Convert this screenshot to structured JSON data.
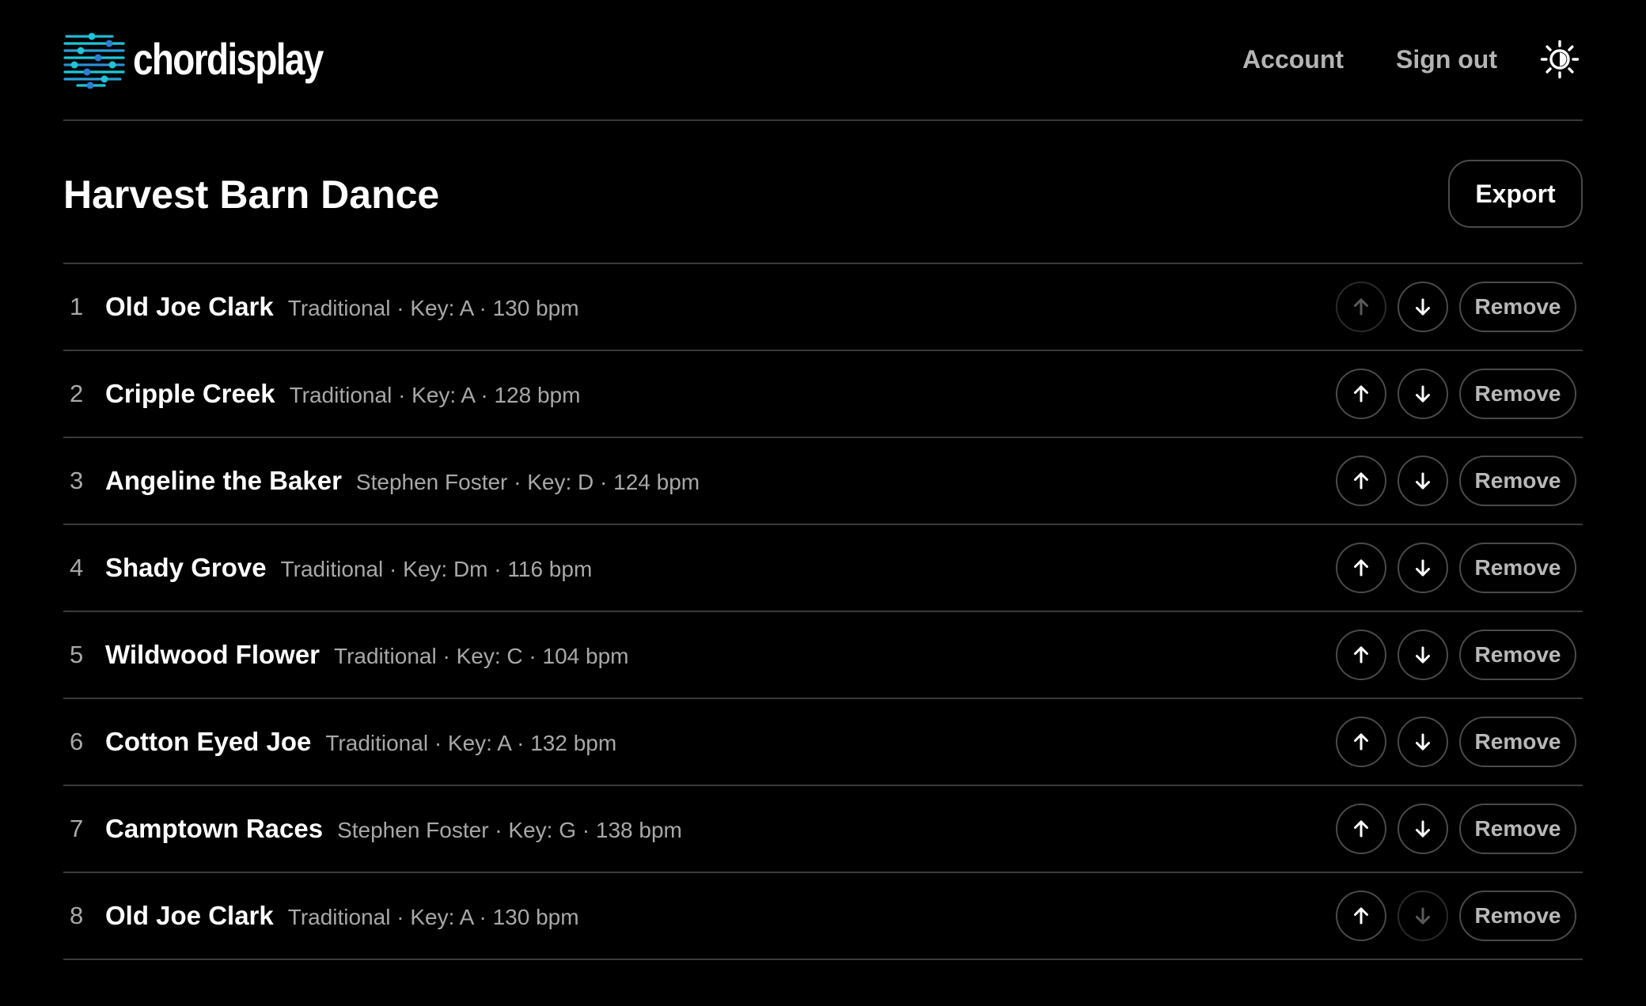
{
  "header": {
    "logo_text": "chordisplay",
    "nav": {
      "account_label": "Account",
      "signout_label": "Sign out"
    },
    "theme_icon": "sun-icon"
  },
  "setlist": {
    "title": "Harvest Barn Dance",
    "export_label": "Export"
  },
  "row_actions": {
    "up_icon": "arrow-up-icon",
    "down_icon": "arrow-down-icon",
    "remove_label": "Remove"
  },
  "songs": [
    {
      "num": "1",
      "title": "Old Joe Clark",
      "meta": "Traditional · Key: A · 130 bpm",
      "up_disabled": true,
      "down_disabled": false
    },
    {
      "num": "2",
      "title": "Cripple Creek",
      "meta": "Traditional · Key: A · 128 bpm",
      "up_disabled": false,
      "down_disabled": false
    },
    {
      "num": "3",
      "title": "Angeline the Baker",
      "meta": "Stephen Foster · Key: D · 124 bpm",
      "up_disabled": false,
      "down_disabled": false
    },
    {
      "num": "4",
      "title": "Shady Grove",
      "meta": "Traditional · Key: Dm · 116 bpm",
      "up_disabled": false,
      "down_disabled": false
    },
    {
      "num": "5",
      "title": "Wildwood Flower",
      "meta": "Traditional · Key: C · 104 bpm",
      "up_disabled": false,
      "down_disabled": false
    },
    {
      "num": "6",
      "title": "Cotton Eyed Joe",
      "meta": "Traditional · Key: A · 132 bpm",
      "up_disabled": false,
      "down_disabled": false
    },
    {
      "num": "7",
      "title": "Camptown Races",
      "meta": "Stephen Foster · Key: G · 138 bpm",
      "up_disabled": false,
      "down_disabled": false
    },
    {
      "num": "8",
      "title": "Old Joe Clark",
      "meta": "Traditional · Key: A · 130 bpm",
      "up_disabled": false,
      "down_disabled": true
    }
  ],
  "colors": {
    "background": "#000000",
    "text_primary": "#ffffff",
    "text_secondary": "#a8a8a8",
    "divider": "#3a3a3a",
    "logo_cyan": "#1ec8d8",
    "logo_blue": "#2a7fd4"
  }
}
